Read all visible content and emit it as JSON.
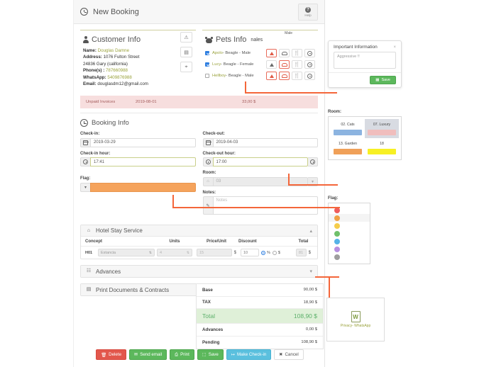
{
  "header": {
    "title": "New Booking",
    "clock_icon": "clock-icon",
    "help_label": "Help",
    "help_icon": "question-icon"
  },
  "customer": {
    "title": "Customer Info",
    "icon": "user-icon",
    "labels": {
      "name": "Name:",
      "address": "Address:",
      "phones": "Phone(s) :",
      "whatsapp": "WhatsApp:",
      "email": "Email:"
    },
    "name": "Douglas Damne",
    "address_line1": "1076 Fulton Street",
    "address_line2": "24836 Gary (california)",
    "phones": "787660988",
    "whatsapp": "5409876988",
    "email": "douglasdm12@gmail.com",
    "side_buttons": [
      {
        "name": "alert-icon",
        "glyph": "⚠"
      },
      {
        "name": "chart-icon",
        "glyph": "▤"
      },
      {
        "name": "location-pin-icon",
        "glyph": "⌖"
      }
    ]
  },
  "pets": {
    "title": "Pets Info",
    "icon": "pet-icon",
    "overlay_text": "nales",
    "tooltip_text": "Male",
    "rows": [
      {
        "checked": true,
        "name": "Apolo",
        "detail": " - Beagle - Male",
        "actions": [
          {
            "name": "warning-icon",
            "state": "red"
          },
          {
            "name": "bed-icon",
            "state": "normal"
          },
          {
            "name": "food-icon",
            "state": "normal"
          },
          {
            "name": "gear-icon",
            "state": "normal"
          }
        ]
      },
      {
        "checked": true,
        "name": "Lucy",
        "detail": " - Beagle - Female",
        "actions": [
          {
            "name": "warning-icon",
            "state": "normal"
          },
          {
            "name": "bed-icon",
            "state": "red"
          },
          {
            "name": "food-icon",
            "state": "normal"
          },
          {
            "name": "gear-icon",
            "state": "normal"
          }
        ]
      },
      {
        "checked": false,
        "name": "Hellboy",
        "detail": " - Beagle -  Male",
        "actions": [
          {
            "name": "warning-icon",
            "state": "red"
          },
          {
            "name": "bed-icon",
            "state": "red"
          },
          {
            "name": "food-icon",
            "state": "normal"
          },
          {
            "name": "gear-icon",
            "state": "normal"
          }
        ]
      }
    ]
  },
  "unpaid": {
    "label": "Unpaid Invoices",
    "date": "2019-08-01",
    "amount": "33,00 $"
  },
  "booking": {
    "title": "Booking Info",
    "icon": "clock-icon",
    "checkin_label": "Check-in:",
    "checkin_value": "2019-03-29",
    "checkout_label": "Check-out:",
    "checkout_value": "2019-04-03",
    "checkin_hour_label": "Check-in hour:",
    "checkin_hour_value": "17:41",
    "checkout_hour_label": "Check-out hour:",
    "checkout_hour_value": "17:00",
    "room_label": "Room:",
    "room_value": "03",
    "flag_label": "Flag:",
    "flag_color": "#f5a35c",
    "notes_label": "Notes:",
    "notes_placeholder": "Notes"
  },
  "accordions": {
    "hotel": {
      "label": "Hotel Stay Service",
      "icon": "building-icon",
      "chevron": "▴",
      "expanded": true
    },
    "advances": {
      "label": "Advances",
      "icon": "card-icon",
      "chevron": "▾",
      "expanded": false
    },
    "print": {
      "label": "Print Documents & Contracts",
      "icon": "printer-icon",
      "chevron": "▾",
      "expanded": false
    }
  },
  "service_table": {
    "columns": [
      "Concept",
      "Units",
      "Price/Unit",
      "Discount",
      "Total"
    ],
    "rows": [
      {
        "code": "H01",
        "concept": "Estancia",
        "units": "4",
        "price_unit": "15",
        "price_currency": "$",
        "discount": "10",
        "discount_mode_percent": true,
        "mode_percent_label": "%",
        "mode_currency_label": "$",
        "total": "81",
        "total_currency": "$"
      }
    ]
  },
  "totals": {
    "rows": [
      {
        "key": "Base",
        "value": "90,00 $",
        "highlight": false
      },
      {
        "key": "TAX",
        "value": "18,90 $",
        "highlight": false
      },
      {
        "key": "Total",
        "value": "108,90 $",
        "highlight": true
      },
      {
        "key": "Advances",
        "value": "0,00 $",
        "highlight": false
      },
      {
        "key": "Pending",
        "value": "108,90 $",
        "highlight": false
      }
    ]
  },
  "footer_buttons": [
    {
      "label": "Delete",
      "style": "red",
      "icon": "trash-icon",
      "glyph": "🗑"
    },
    {
      "label": "Send email",
      "style": "green",
      "icon": "envelope-icon",
      "glyph": "✉"
    },
    {
      "label": "Print",
      "style": "green",
      "icon": "printer-icon",
      "glyph": "⎙"
    },
    {
      "label": "Save",
      "style": "green",
      "icon": "save-icon",
      "glyph": "⬚"
    },
    {
      "label": "Make Check-in",
      "style": "blue",
      "icon": "checkin-icon",
      "glyph": "↦"
    },
    {
      "label": "Cancel",
      "style": "white",
      "icon": "close-icon",
      "glyph": "✖"
    }
  ],
  "important_modal": {
    "title": "Important Information",
    "close_icon": "close-icon",
    "textarea_value": "Aggressive !!",
    "save_label": "Save",
    "save_icon": "save-icon"
  },
  "room_picker": {
    "label": "Room:",
    "cells": [
      {
        "name": "02. Cats",
        "color": "#8cb4e0",
        "selected": false
      },
      {
        "name": "07. Luxury",
        "color": "#f0bdbd",
        "selected": true
      },
      {
        "name": "13. Garden",
        "color": "#f0a058",
        "selected": false
      },
      {
        "name": "18",
        "color": "#f7f024",
        "selected": false
      }
    ]
  },
  "flag_picker": {
    "label": "Flag:",
    "options": [
      {
        "name": "flag-red",
        "color": "#ef5d5d",
        "highlighted": false
      },
      {
        "name": "flag-orange",
        "color": "#f0a045",
        "highlighted": true
      },
      {
        "name": "flag-yellow",
        "color": "#f5cd4b",
        "highlighted": false
      },
      {
        "name": "flag-green",
        "color": "#6fc06a",
        "highlighted": false
      },
      {
        "name": "flag-blue",
        "color": "#55b2e8",
        "highlighted": false
      },
      {
        "name": "flag-purple",
        "color": "#b78fe0",
        "highlighted": false
      },
      {
        "name": "flag-gray",
        "color": "#9e9e9e",
        "highlighted": false
      }
    ]
  },
  "document_card": {
    "label": "Privacy- WhatsApp",
    "icon": "word-document-icon",
    "glyph": "W"
  }
}
